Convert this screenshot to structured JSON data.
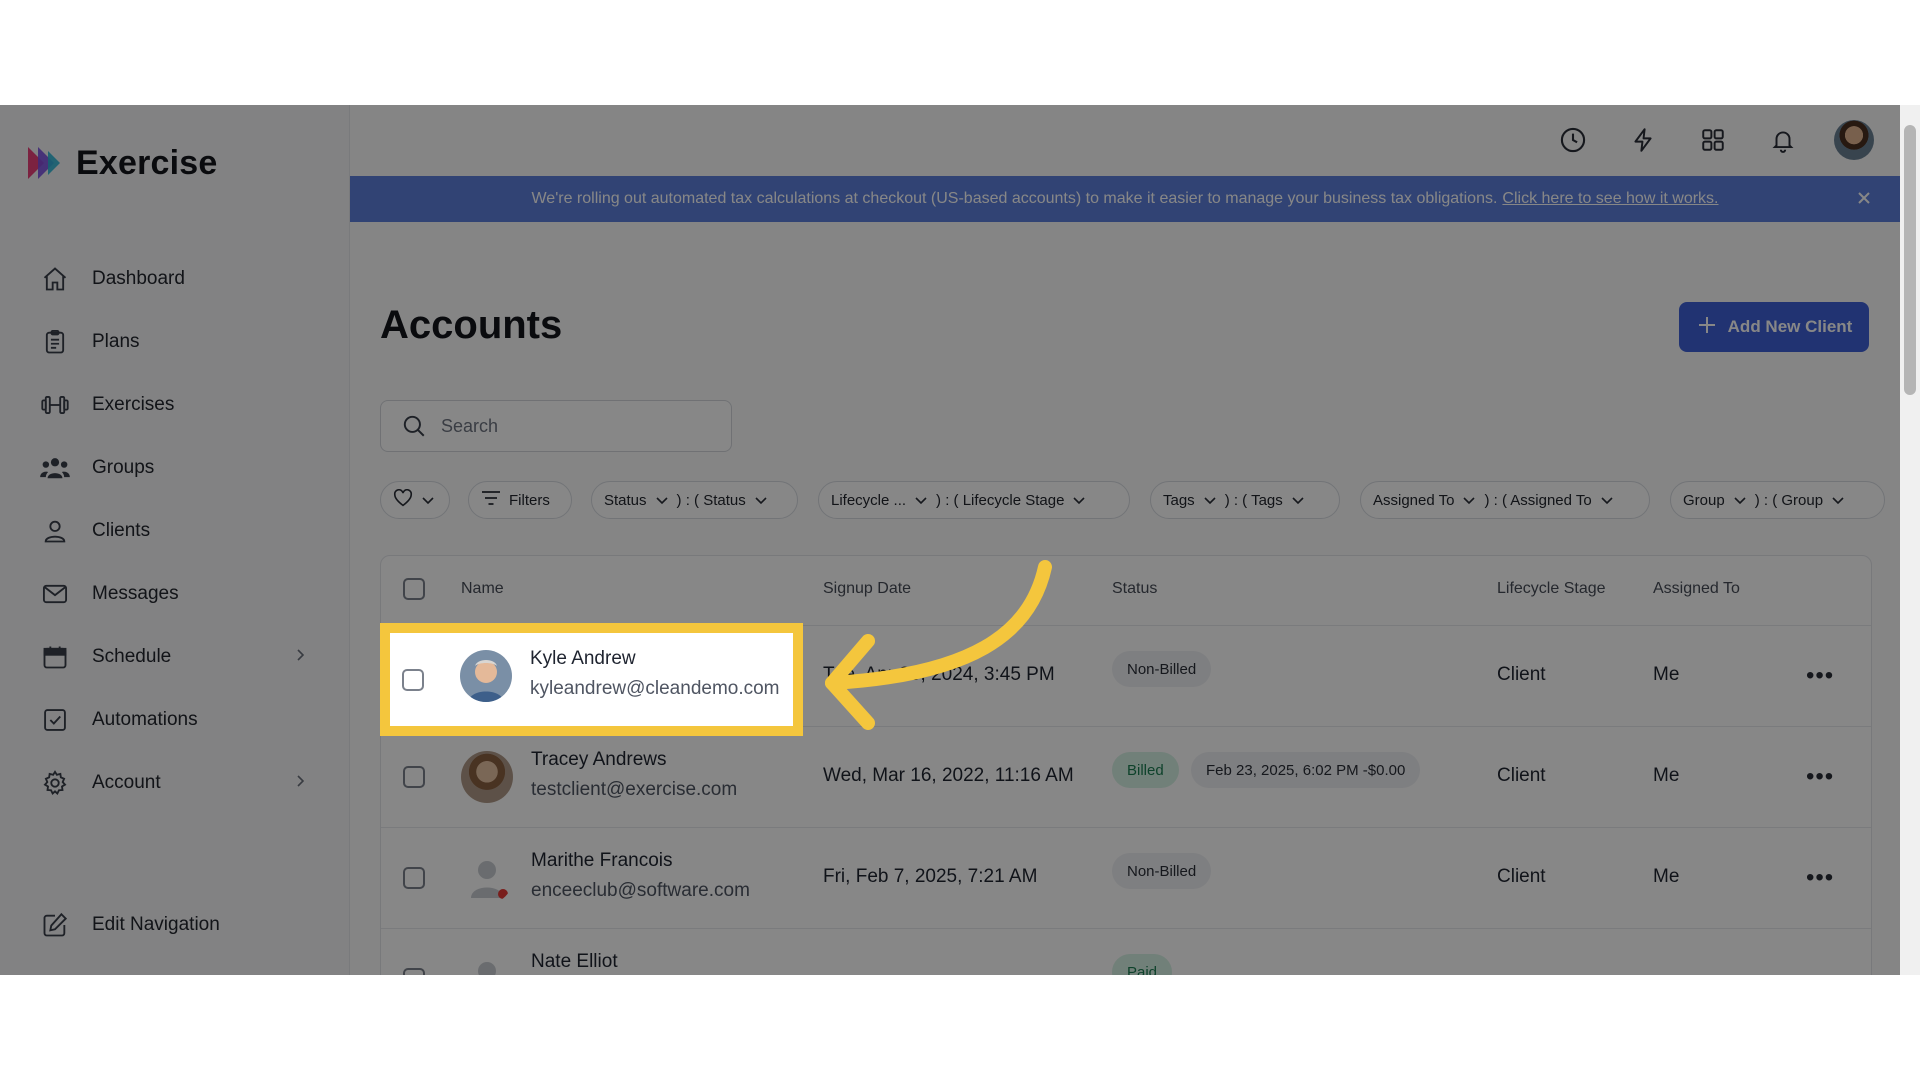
{
  "app": {
    "name": "Exercise"
  },
  "sidebar": {
    "items": [
      {
        "label": "Dashboard",
        "icon": "home-icon"
      },
      {
        "label": "Plans",
        "icon": "clipboard-icon"
      },
      {
        "label": "Exercises",
        "icon": "dumbbell-icon"
      },
      {
        "label": "Groups",
        "icon": "users-icon"
      },
      {
        "label": "Clients",
        "icon": "user-icon"
      },
      {
        "label": "Messages",
        "icon": "mail-icon"
      },
      {
        "label": "Schedule",
        "icon": "calendar-icon",
        "has_submenu": true
      },
      {
        "label": "Automations",
        "icon": "check-square-icon"
      },
      {
        "label": "Account",
        "icon": "gear-icon",
        "has_submenu": true
      }
    ],
    "edit_nav": "Edit Navigation"
  },
  "banner": {
    "text": "We're rolling out automated tax calculations at checkout (US-based accounts) to make it easier to manage your business tax obligations.",
    "link": "Click here to see how it works."
  },
  "page": {
    "title": "Accounts",
    "add_button": "Add New Client",
    "search_placeholder": "Search"
  },
  "filters": {
    "filters_label": "Filters",
    "status": "Status",
    "status_value": ") : ( Status",
    "lifecycle": "Lifecycle ...",
    "lifecycle_value": ") : ( Lifecycle Stage",
    "tags": "Tags",
    "tags_value": ") : ( Tags",
    "assigned": "Assigned To",
    "assigned_value": ") : ( Assigned To",
    "group": "Group",
    "group_value": ") : ( Group"
  },
  "table": {
    "columns": [
      "Name",
      "Signup Date",
      "Status",
      "Lifecycle Stage",
      "Assigned To"
    ],
    "rows": [
      {
        "name": "Kyle Andrew",
        "email": "kyleandrew@cleandemo.com",
        "signup": "Tue, Apr 30, 2024, 3:45 PM",
        "status": "Non-Billed",
        "status_extra": "",
        "lifecycle": "Client",
        "assigned": "Me"
      },
      {
        "name": "Tracey Andrews",
        "email": "testclient@exercise.com",
        "signup": "Wed, Mar 16, 2022, 11:16 AM",
        "status": "Billed",
        "status_extra": "Feb 23, 2025, 6:02 PM -$0.00",
        "lifecycle": "Client",
        "assigned": "Me"
      },
      {
        "name": "Marithe Francois",
        "email": "enceeclub@software.com",
        "signup": "Fri, Feb 7, 2025, 7:21 AM",
        "status": "Non-Billed",
        "status_extra": "",
        "lifecycle": "Client",
        "assigned": "Me"
      },
      {
        "name": "Nate Elliot",
        "email": "",
        "signup": "",
        "status": "Paid",
        "status_extra": "",
        "lifecycle": "",
        "assigned": ""
      }
    ]
  },
  "colors": {
    "accent": "#3f61d8",
    "banner": "#5e7fdb",
    "highlight": "#f4c63d"
  }
}
